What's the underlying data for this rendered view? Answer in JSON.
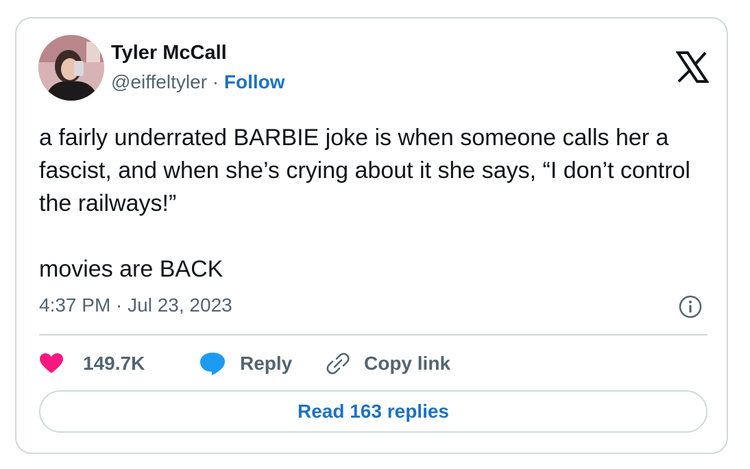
{
  "author": {
    "name": "Tyler McCall",
    "handle": "@eiffeltyler",
    "separator": " · ",
    "follow_label": "Follow",
    "avatar_icon": "profile-photo"
  },
  "tweet": {
    "text": "a fairly underrated BARBIE joke is when someone calls her a fascist, and when she’s crying about it she says, “I don’t control the railways!”\n\nmovies are BACK",
    "timestamp": "4:37 PM · Jul 23, 2023"
  },
  "actions": {
    "likes_count": "149.7K",
    "reply_label": "Reply",
    "copy_link_label": "Copy link"
  },
  "read_replies_label": "Read 163 replies",
  "icons": [
    "x-logo-icon",
    "info-icon",
    "heart-icon",
    "reply-bubble-icon",
    "link-icon"
  ],
  "colors": {
    "link_blue": "#1d72c4",
    "heart_pink": "#f91880",
    "reply_blue": "#1d9bf0",
    "secondary_text": "#536471",
    "border": "#cfd9de"
  }
}
